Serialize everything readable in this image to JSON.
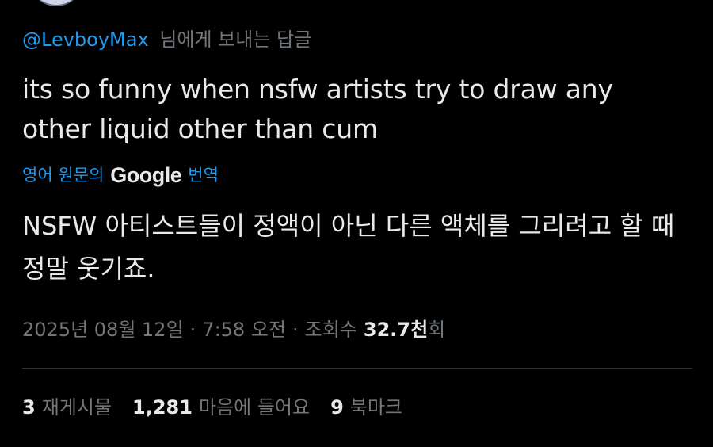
{
  "reply": {
    "handle": "@LevboyMax",
    "suffix": "님에게 보내는 답글"
  },
  "tweet": {
    "text": "its so funny when nsfw artists try to draw any other liquid other than cum"
  },
  "translate": {
    "prefix": "영어 원문의",
    "brand": "Google",
    "suffix": "번역"
  },
  "translation": {
    "text": "NSFW 아티스트들이 정액이 아닌 다른 액체를 그리려고 할 때 정말 웃기죠."
  },
  "meta": {
    "date": "2025년 08월 12일",
    "time": "7:58 오전",
    "views_label": "조회수",
    "views_value": "32.7천",
    "views_suffix": "회",
    "separator": "·"
  },
  "stats": {
    "reposts_count": "3",
    "reposts_label": "재게시물",
    "likes_count": "1,281",
    "likes_label": "마음에 들어요",
    "bookmarks_count": "9",
    "bookmarks_label": "북마크"
  },
  "colors": {
    "background": "#000000",
    "accent": "#1d9bf0",
    "text": "#e7e9ea",
    "secondary": "#71767b",
    "divider": "#2f3336"
  }
}
